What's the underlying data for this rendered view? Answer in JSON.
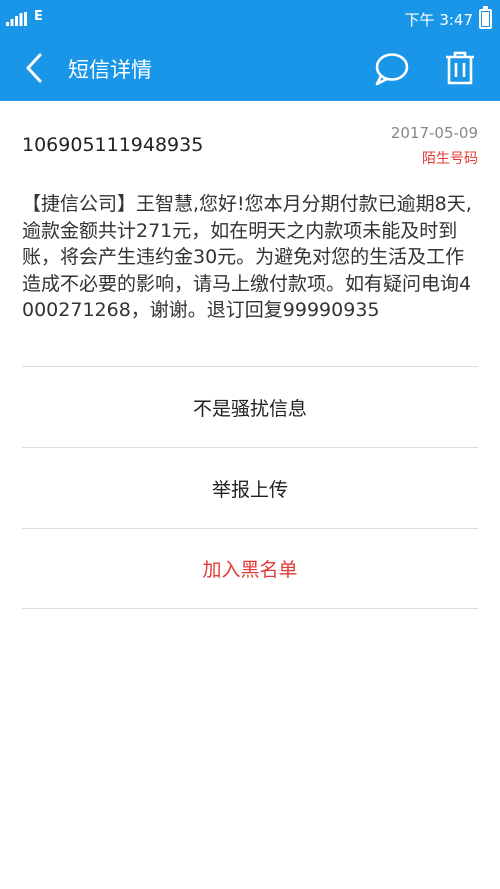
{
  "status_bar": {
    "network_type": "E",
    "time": "下午 3:47",
    "signal_icon": "signal-bars-icon",
    "battery_icon": "battery-icon"
  },
  "nav": {
    "title": "短信详情",
    "back_icon": "chevron-left-icon",
    "chat_icon": "chat-bubble-icon",
    "delete_icon": "trash-icon"
  },
  "message": {
    "sender": "106905111948935",
    "date": "2017-05-09",
    "tag": "陌生号码",
    "body": "【捷信公司】王智慧,您好!您本月分期付款已逾期8天, 逾款金额共计271元，如在明天之内款项未能及时到账，将会产生违约金30元。为避免对您的生活及工作造成不必要的影响，请马上缴付款项。如有疑问电询4000271268，谢谢。退订回复99990935"
  },
  "actions": {
    "not_spam": "不是骚扰信息",
    "report": "举报上传",
    "blacklist": "加入黑名单"
  },
  "colors": {
    "header_bg": "#1a96e8",
    "danger": "#e53935",
    "date_gray": "#888888"
  }
}
